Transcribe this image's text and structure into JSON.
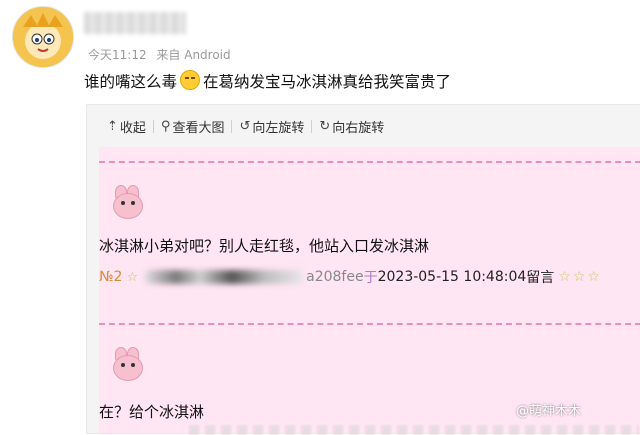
{
  "post": {
    "meta": {
      "time": "今天11:12",
      "source": "来自 Android"
    },
    "text_before_emoji": "谁的嘴这么毒",
    "emoji": "laughing-crying",
    "text_after_emoji": "在葛纳发宝马冰淇淋真给我笑富贵了"
  },
  "viewer": {
    "toolbar": {
      "collapse": "收起",
      "view_large": "查看大图",
      "rotate_left": "向左旋转",
      "rotate_right": "向右旋转"
    },
    "screenshot": {
      "background": "#ffe6f2",
      "comment1": {
        "text": "冰淇淋小弟对吧？别人走红毯，他站入口发冰淇淋",
        "floor": "№2",
        "user_id_visible": "a208fee",
        "yu": "于",
        "timestamp": "2023-05-15 10:48:04",
        "label": "留言"
      },
      "comment2": {
        "text": "在？给个冰淇淋"
      }
    }
  },
  "watermark": "@萌神木木"
}
